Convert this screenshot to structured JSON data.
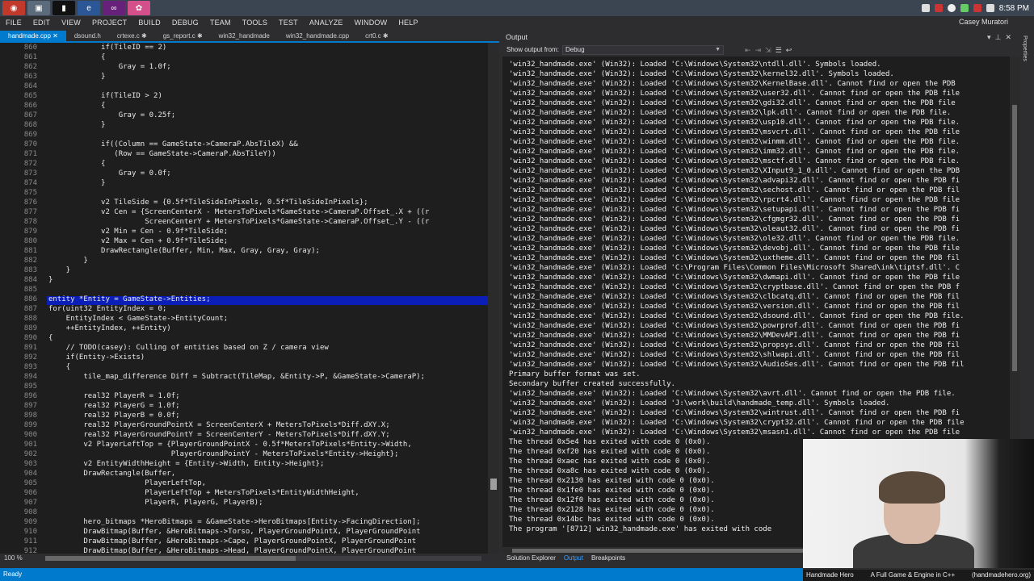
{
  "taskbar": {
    "apps": [
      {
        "name": "chrome-app",
        "glyph": "◉"
      },
      {
        "name": "explorer-app",
        "glyph": "▣"
      },
      {
        "name": "cmd-app",
        "glyph": "▮"
      },
      {
        "name": "ie-app",
        "glyph": "e"
      },
      {
        "name": "visual-studio-app",
        "glyph": "∞"
      },
      {
        "name": "paint-app",
        "glyph": "✿"
      }
    ],
    "clock": "8:58 PM"
  },
  "menu": [
    "FILE",
    "EDIT",
    "VIEW",
    "PROJECT",
    "BUILD",
    "DEBUG",
    "TEAM",
    "TOOLS",
    "TEST",
    "ANALYZE",
    "WINDOW",
    "HELP"
  ],
  "user_name": "Casey Muratori",
  "editor": {
    "tabs": [
      {
        "label": "handmade.cpp  ✕",
        "active": true
      },
      {
        "label": "dsound.h",
        "active": false
      },
      {
        "label": "crtexe.c  ✱",
        "active": false
      },
      {
        "label": "gs_report.c  ✱",
        "active": false
      },
      {
        "label": "win32_handmade",
        "active": false
      },
      {
        "label": "win32_handmade.cpp",
        "active": false
      },
      {
        "label": "crt0.c  ✱",
        "active": false
      }
    ],
    "zoom": "100 %",
    "lines": [
      {
        "n": "860",
        "t": "            if(TileID == 2)"
      },
      {
        "n": "861",
        "t": "            {"
      },
      {
        "n": "862",
        "t": "                Gray = 1.0f;"
      },
      {
        "n": "863",
        "t": "            }"
      },
      {
        "n": "864",
        "t": ""
      },
      {
        "n": "865",
        "t": "            if(TileID > 2)"
      },
      {
        "n": "866",
        "t": "            {"
      },
      {
        "n": "867",
        "t": "                Gray = 0.25f;"
      },
      {
        "n": "868",
        "t": "            }"
      },
      {
        "n": "869",
        "t": ""
      },
      {
        "n": "870",
        "t": "            if((Column == GameState->CameraP.AbsTileX) &&"
      },
      {
        "n": "871",
        "t": "               (Row == GameState->CameraP.AbsTileY))"
      },
      {
        "n": "872",
        "t": "            {"
      },
      {
        "n": "873",
        "t": "                Gray = 0.0f;"
      },
      {
        "n": "874",
        "t": "            }"
      },
      {
        "n": "875",
        "t": ""
      },
      {
        "n": "876",
        "t": "            v2 TileSide = {0.5f*TileSideInPixels, 0.5f*TileSideInPixels};"
      },
      {
        "n": "877",
        "t": "            v2 Cen = {ScreenCenterX - MetersToPixels*GameState->CameraP.Offset_.X + ((r"
      },
      {
        "n": "878",
        "t": "                      ScreenCenterY + MetersToPixels*GameState->CameraP.Offset_.Y - ((r"
      },
      {
        "n": "879",
        "t": "            v2 Min = Cen - 0.9f*TileSide;"
      },
      {
        "n": "880",
        "t": "            v2 Max = Cen + 0.9f*TileSide;"
      },
      {
        "n": "881",
        "t": "            DrawRectangle(Buffer, Min, Max, Gray, Gray, Gray);"
      },
      {
        "n": "882",
        "t": "        }"
      },
      {
        "n": "883",
        "t": "    }"
      },
      {
        "n": "884",
        "t": "}"
      },
      {
        "n": "885",
        "t": ""
      },
      {
        "n": "886",
        "t": "entity *Entity = GameState->Entities;"
      },
      {
        "n": "887",
        "t": "for(uint32 EntityIndex = 0;"
      },
      {
        "n": "888",
        "t": "    EntityIndex < GameState->EntityCount;"
      },
      {
        "n": "889",
        "t": "    ++EntityIndex, ++Entity)"
      },
      {
        "n": "890",
        "t": "{"
      },
      {
        "n": "891",
        "t": "    // TODO(casey): Culling of entities based on Z / camera view"
      },
      {
        "n": "892",
        "t": "    if(Entity->Exists)"
      },
      {
        "n": "893",
        "t": "    {"
      },
      {
        "n": "894",
        "t": "        tile_map_difference Diff = Subtract(TileMap, &Entity->P, &GameState->CameraP);"
      },
      {
        "n": "895",
        "t": ""
      },
      {
        "n": "896",
        "t": "        real32 PlayerR = 1.0f;"
      },
      {
        "n": "897",
        "t": "        real32 PlayerG = 1.0f;"
      },
      {
        "n": "898",
        "t": "        real32 PlayerB = 0.0f;"
      },
      {
        "n": "899",
        "t": "        real32 PlayerGroundPointX = ScreenCenterX + MetersToPixels*Diff.dXY.X;"
      },
      {
        "n": "900",
        "t": "        real32 PlayerGroundPointY = ScreenCenterY - MetersToPixels*Diff.dXY.Y;"
      },
      {
        "n": "901",
        "t": "        v2 PlayerLeftTop = {PlayerGroundPointX - 0.5f*MetersToPixels*Entity->Width,"
      },
      {
        "n": "902",
        "t": "                            PlayerGroundPointY - MetersToPixels*Entity->Height};"
      },
      {
        "n": "903",
        "t": "        v2 EntityWidthHeight = {Entity->Width, Entity->Height};"
      },
      {
        "n": "904",
        "t": "        DrawRectangle(Buffer,"
      },
      {
        "n": "905",
        "t": "                      PlayerLeftTop,"
      },
      {
        "n": "906",
        "t": "                      PlayerLeftTop + MetersToPixels*EntityWidthHeight,"
      },
      {
        "n": "907",
        "t": "                      PlayerR, PlayerG, PlayerB);"
      },
      {
        "n": "908",
        "t": ""
      },
      {
        "n": "909",
        "t": "        hero_bitmaps *HeroBitmaps = &GameState->HeroBitmaps[Entity->FacingDirection];"
      },
      {
        "n": "910",
        "t": "        DrawBitmap(Buffer, &HeroBitmaps->Torso, PlayerGroundPointX, PlayerGroundPoint"
      },
      {
        "n": "911",
        "t": "        DrawBitmap(Buffer, &HeroBitmaps->Cape, PlayerGroundPointX, PlayerGroundPoint"
      },
      {
        "n": "912",
        "t": "        DrawBitmap(Buffer, &HeroBitmaps->Head, PlayerGroundPointX, PlayerGroundPoint"
      }
    ]
  },
  "output": {
    "title": "Output",
    "show_output_label": "Show output from:",
    "source": "Debug",
    "lines": [
      "'win32_handmade.exe' (Win32): Loaded 'C:\\Windows\\System32\\ntdll.dll'. Symbols loaded.",
      "'win32_handmade.exe' (Win32): Loaded 'C:\\Windows\\System32\\kernel32.dll'. Symbols loaded.",
      "'win32_handmade.exe' (Win32): Loaded 'C:\\Windows\\System32\\KernelBase.dll'. Cannot find or open the PDB",
      "'win32_handmade.exe' (Win32): Loaded 'C:\\Windows\\System32\\user32.dll'. Cannot find or open the PDB file",
      "'win32_handmade.exe' (Win32): Loaded 'C:\\Windows\\System32\\gdi32.dll'. Cannot find or open the PDB file",
      "'win32_handmade.exe' (Win32): Loaded 'C:\\Windows\\System32\\lpk.dll'. Cannot find or open the PDB file.",
      "'win32_handmade.exe' (Win32): Loaded 'C:\\Windows\\System32\\usp10.dll'. Cannot find or open the PDB file.",
      "'win32_handmade.exe' (Win32): Loaded 'C:\\Windows\\System32\\msvcrt.dll'. Cannot find or open the PDB file",
      "'win32_handmade.exe' (Win32): Loaded 'C:\\Windows\\System32\\winmm.dll'. Cannot find or open the PDB file.",
      "'win32_handmade.exe' (Win32): Loaded 'C:\\Windows\\System32\\imm32.dll'. Cannot find or open the PDB file.",
      "'win32_handmade.exe' (Win32): Loaded 'C:\\Windows\\System32\\msctf.dll'. Cannot find or open the PDB file.",
      "'win32_handmade.exe' (Win32): Loaded 'C:\\Windows\\System32\\XInput9_1_0.dll'. Cannot find or open the PDB",
      "'win32_handmade.exe' (Win32): Loaded 'C:\\Windows\\System32\\advapi32.dll'. Cannot find or open the PDB fi",
      "'win32_handmade.exe' (Win32): Loaded 'C:\\Windows\\System32\\sechost.dll'. Cannot find or open the PDB fil",
      "'win32_handmade.exe' (Win32): Loaded 'C:\\Windows\\System32\\rpcrt4.dll'. Cannot find or open the PDB file",
      "'win32_handmade.exe' (Win32): Loaded 'C:\\Windows\\System32\\setupapi.dll'. Cannot find or open the PDB fi",
      "'win32_handmade.exe' (Win32): Loaded 'C:\\Windows\\System32\\cfgmgr32.dll'. Cannot find or open the PDB fi",
      "'win32_handmade.exe' (Win32): Loaded 'C:\\Windows\\System32\\oleaut32.dll'. Cannot find or open the PDB fi",
      "'win32_handmade.exe' (Win32): Loaded 'C:\\Windows\\System32\\ole32.dll'. Cannot find or open the PDB file.",
      "'win32_handmade.exe' (Win32): Loaded 'C:\\Windows\\System32\\devobj.dll'. Cannot find or open the PDB file",
      "'win32_handmade.exe' (Win32): Loaded 'C:\\Windows\\System32\\uxtheme.dll'. Cannot find or open the PDB fil",
      "'win32_handmade.exe' (Win32): Loaded 'C:\\Program Files\\Common Files\\Microsoft Shared\\ink\\tiptsf.dll'. C",
      "'win32_handmade.exe' (Win32): Loaded 'C:\\Windows\\System32\\dwmapi.dll'. Cannot find or open the PDB file",
      "'win32_handmade.exe' (Win32): Loaded 'C:\\Windows\\System32\\cryptbase.dll'. Cannot find or open the PDB f",
      "'win32_handmade.exe' (Win32): Loaded 'C:\\Windows\\System32\\clbcatq.dll'. Cannot find or open the PDB fil",
      "'win32_handmade.exe' (Win32): Loaded 'C:\\Windows\\System32\\version.dll'. Cannot find or open the PDB fil",
      "'win32_handmade.exe' (Win32): Loaded 'C:\\Windows\\System32\\dsound.dll'. Cannot find or open the PDB file.",
      "'win32_handmade.exe' (Win32): Loaded 'C:\\Windows\\System32\\powrprof.dll'. Cannot find or open the PDB fi",
      "'win32_handmade.exe' (Win32): Loaded 'C:\\Windows\\System32\\MMDevAPI.dll'. Cannot find or open the PDB fi",
      "'win32_handmade.exe' (Win32): Loaded 'C:\\Windows\\System32\\propsys.dll'. Cannot find or open the PDB fil",
      "'win32_handmade.exe' (Win32): Loaded 'C:\\Windows\\System32\\shlwapi.dll'. Cannot find or open the PDB fil",
      "'win32_handmade.exe' (Win32): Loaded 'C:\\Windows\\System32\\AudioSes.dll'. Cannot find or open the PDB fil",
      "Primary buffer format was set.",
      "Secondary buffer created successfully.",
      "'win32_handmade.exe' (Win32): Loaded 'C:\\Windows\\System32\\avrt.dll'. Cannot find or open the PDB file.",
      "'win32_handmade.exe' (Win32): Loaded 'J:\\work\\build\\handmade_temp.dll'. Symbols loaded.",
      "'win32_handmade.exe' (Win32): Loaded 'C:\\Windows\\System32\\wintrust.dll'. Cannot find or open the PDB fi",
      "'win32_handmade.exe' (Win32): Loaded 'C:\\Windows\\System32\\crypt32.dll'. Cannot find or open the PDB file",
      "'win32_handmade.exe' (Win32): Loaded 'C:\\Windows\\System32\\msasn1.dll'. Cannot find or open the PDB file",
      "The thread 0x5e4 has exited with code 0 (0x0).",
      "The thread 0xf20 has exited with code 0 (0x0).",
      "The thread 0xaec has exited with code 0 (0x0).",
      "The thread 0xa8c has exited with code 0 (0x0).",
      "The thread 0x2130 has exited with code 0 (0x0).",
      "The thread 0x1fe0 has exited with code 0 (0x0).",
      "The thread 0x12f0 has exited with code 0 (0x0).",
      "The thread 0x2128 has exited with code 0 (0x0).",
      "The thread 0x14bc has exited with code 0 (0x0).",
      "The program '[8712] win32_handmade.exe' has exited with code"
    ],
    "bottom_tabs": [
      {
        "label": "Solution Explorer",
        "active": false
      },
      {
        "label": "Output",
        "active": true
      },
      {
        "label": "Breakpoints",
        "active": false
      }
    ]
  },
  "right_strip": {
    "label": "Properties"
  },
  "webcam_caption": {
    "left": "Handmade Hero",
    "center": "A Full Game & Engine in C++",
    "right": "(handmadehero.org)"
  },
  "status": "Ready",
  "colors": {
    "accent": "#007acc",
    "current_line": "#0b1fb8",
    "editor_bg": "#1e1e1e"
  }
}
